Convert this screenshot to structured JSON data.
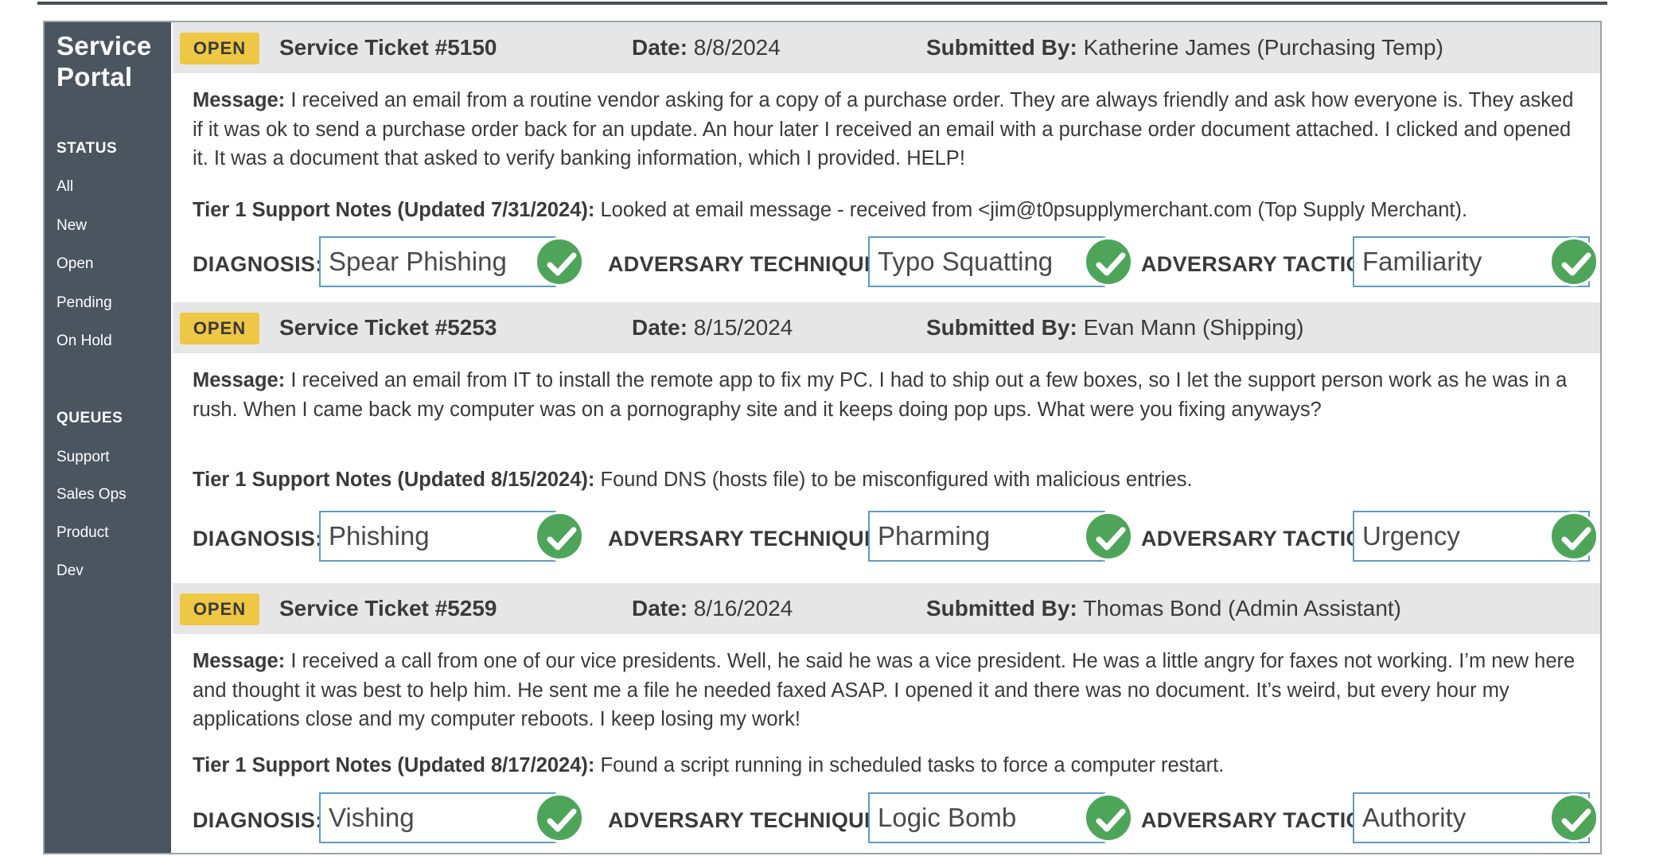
{
  "sidebar": {
    "brand_line1": "Service",
    "brand_line2": "Portal",
    "status_heading": "STATUS",
    "status_items": [
      "All",
      "New",
      "Open",
      "Pending",
      "On Hold"
    ],
    "queues_heading": "QUEUES",
    "queue_items": [
      "Support",
      "Sales Ops",
      "Product",
      "Dev"
    ]
  },
  "labels": {
    "date": "Date:",
    "submitted_by": "Submitted By:",
    "message": "Message:",
    "diagnosis": "DIAGNOSIS:",
    "technique": "ADVERSARY TECHNIQUE:",
    "tactic": "ADVERSARY TACTIC:"
  },
  "colors": {
    "sidebar": "#4a5560",
    "status_badge": "#eec745",
    "header_bar": "#e6e6e6",
    "answer_border": "#5b9bc6",
    "check": "#4ea55a"
  },
  "tickets": [
    {
      "status": "OPEN",
      "title": "Service Ticket #5150",
      "date": "8/8/2024",
      "submitted_by": "Katherine James (Purchasing Temp)",
      "message": "I received an email from a routine vendor asking for a copy of a purchase order. They are always friendly and ask how everyone is. They asked if it was ok to send a purchase order back for an update. An hour later I received an email with a purchase order document attached. I clicked and opened it. It was a document that asked to verify banking information, which I provided. HELP!",
      "notes_label": "Tier 1 Support Notes (Updated 7/31/2024):",
      "notes": "Looked at email message - received from <jim@t0psupplymerchant.com (Top Supply Merchant).",
      "diagnosis": "Spear Phishing",
      "technique": "Typo Squatting",
      "tactic": "Familiarity",
      "correct": "check-icon"
    },
    {
      "status": "OPEN",
      "title": "Service Ticket #5253",
      "date": "8/15/2024",
      "submitted_by": "Evan Mann (Shipping)",
      "message": "I received an email from IT to install the remote app to fix my PC. I had to ship out a few boxes, so I let the support person work as he was in a rush. When I came back my computer was on a pornography site and it keeps doing pop ups. What were you fixing anyways?",
      "notes_label": "Tier 1 Support Notes (Updated 8/15/2024):",
      "notes": "Found DNS (hosts file) to be misconfigured with malicious entries.",
      "diagnosis": "Phishing",
      "technique": "Pharming",
      "tactic": "Urgency",
      "correct": "check-icon"
    },
    {
      "status": "OPEN",
      "title": "Service Ticket #5259",
      "date": "8/16/2024",
      "submitted_by": "Thomas Bond (Admin Assistant)",
      "message": "I received a call from one of our vice presidents. Well, he said he was a vice president. He was a little angry for faxes not working. I’m new here and thought it was best to help him. He sent me a file he needed faxed ASAP. I opened it and there was no document. It’s weird, but every hour my applications close and my computer reboots. I keep losing my work!",
      "notes_label": "Tier 1 Support Notes (Updated 8/17/2024):",
      "notes": "Found a script running in scheduled tasks to force a computer restart.",
      "diagnosis": "Vishing",
      "technique": "Logic Bomb",
      "tactic": "Authority",
      "correct": "check-icon"
    }
  ]
}
